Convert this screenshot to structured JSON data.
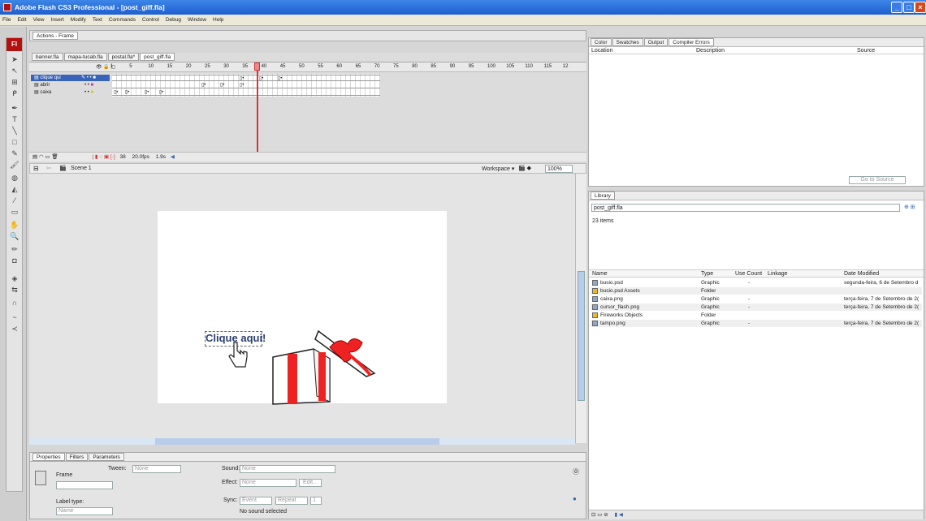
{
  "window": {
    "title": "Adobe Flash CS3 Professional - [post_giff.fla]"
  },
  "menu": [
    "File",
    "Edit",
    "View",
    "Insert",
    "Modify",
    "Text",
    "Commands",
    "Control",
    "Debug",
    "Window",
    "Help"
  ],
  "tools": {
    "logo": "Fl"
  },
  "actions_panel": {
    "tab": "Actions - Frame"
  },
  "doc_tabs": [
    "banner.fla",
    "mapa-tucab.fla",
    "postal.fla*",
    "post_giff.fla"
  ],
  "timeline": {
    "ruler": [
      "1",
      "5",
      "10",
      "15",
      "20",
      "25",
      "30",
      "35",
      "40",
      "45",
      "50",
      "55",
      "60",
      "65",
      "70",
      "75",
      "80",
      "85",
      "90",
      "95",
      "100",
      "105",
      "110",
      "115",
      "12"
    ],
    "layers": [
      {
        "name": "clique qui"
      },
      {
        "name": "abrir"
      },
      {
        "name": "caixa"
      }
    ],
    "status": {
      "frame": "38",
      "fps": "20.0fps",
      "time": "1.9s"
    }
  },
  "edit_bar": {
    "scene": "Scene 1",
    "workspace": "Workspace ▾",
    "zoom": "100%"
  },
  "stage": {
    "button_text": "Clique aqui!"
  },
  "properties": {
    "tabs": [
      "Properties",
      "Filters",
      "Parameters"
    ],
    "frame_label": "Frame",
    "tween_label": "Tween:",
    "tween_value": "None",
    "sound_label": "Sound:",
    "sound_value": "None",
    "effect_label": "Effect:",
    "effect_value": "None",
    "edit_btn": "Edit...",
    "sync_label": "Sync:",
    "sync_value": "Event",
    "repeat_value": "Repeat",
    "repeat_count": "1",
    "label_type": "Label type:",
    "label_type_value": "Name",
    "no_sound": "No sound selected"
  },
  "compiler": {
    "tabs": [
      "Color",
      "Swatches",
      "Output",
      "Compiler Errors"
    ],
    "headers": [
      "Location",
      "Description",
      "Source"
    ],
    "goto": "Go to Source"
  },
  "library": {
    "tab": "Library",
    "doc": "post_giff.fla",
    "count": "23 items",
    "headers": [
      "Name",
      "Type",
      "Use Count",
      "Linkage",
      "Date Modified"
    ],
    "items": [
      {
        "name": "busio.psd",
        "type": "Graphic",
        "use": "-",
        "link": "",
        "date": "segunda-feira, 6 de Setembro d",
        "icon": "graphic"
      },
      {
        "name": "busio.psd Assets",
        "type": "Folder",
        "use": "",
        "link": "",
        "date": "",
        "icon": "folder"
      },
      {
        "name": "caixa.png",
        "type": "Graphic",
        "use": "-",
        "link": "",
        "date": "terça-feira, 7 de Setembro de 2(",
        "icon": "graphic"
      },
      {
        "name": "cursor_flash.png",
        "type": "Graphic",
        "use": "-",
        "link": "",
        "date": "terça-feira, 7 de Setembro de 2(",
        "icon": "graphic"
      },
      {
        "name": "Fireworks Objects",
        "type": "Folder",
        "use": "",
        "link": "",
        "date": "",
        "icon": "folder"
      },
      {
        "name": "tampo.png",
        "type": "Graphic",
        "use": "-",
        "link": "",
        "date": "terça-feira, 7 de Setembro de 2(",
        "icon": "graphic"
      }
    ]
  }
}
